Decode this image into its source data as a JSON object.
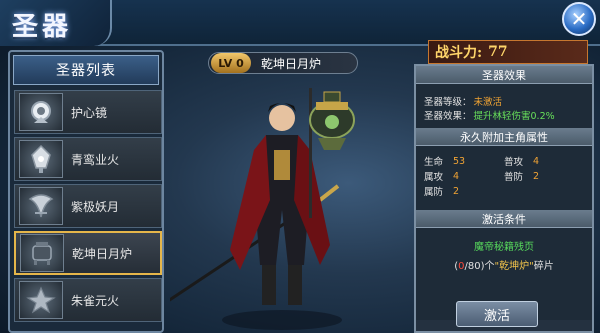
{
  "header": {
    "title": "圣器",
    "close_glyph": "✕"
  },
  "list": {
    "title": "圣器列表",
    "items": [
      {
        "label": "护心镜",
        "icon": "mirror-icon",
        "selected": false
      },
      {
        "label": "青鸾业火",
        "icon": "lantern-icon",
        "selected": false
      },
      {
        "label": "紫极妖月",
        "icon": "moon-blade-icon",
        "selected": false
      },
      {
        "label": "乾坤日月炉",
        "icon": "cauldron-icon",
        "selected": true
      },
      {
        "label": "朱雀元火",
        "icon": "phoenix-icon",
        "selected": false
      }
    ]
  },
  "artifact": {
    "level": "LV 0",
    "name": "乾坤日月炉"
  },
  "power": {
    "label": "战斗力:",
    "value": "77"
  },
  "effect": {
    "title": "圣器效果",
    "level_label": "圣器等级：",
    "level_value": "未激活",
    "skill_label": "圣器效果：",
    "skill_value": "提升林轻伤害0.2%"
  },
  "attrs": {
    "title": "永久附加主角属性",
    "items": [
      {
        "label": "生命",
        "value": "53"
      },
      {
        "label": "普攻",
        "value": "4"
      },
      {
        "label": "属攻",
        "value": "4"
      },
      {
        "label": "普防",
        "value": "2"
      },
      {
        "label": "属防",
        "value": "2"
      }
    ]
  },
  "activate": {
    "title": "激活条件",
    "material": "魔帝秘籍残页",
    "count_open": "(",
    "count_have": "0",
    "count_need": "/80",
    "count_mid": ")个",
    "item_name": "\"乾坤炉\"",
    "count_suffix": "碎片",
    "button_label": "激活"
  },
  "colors": {
    "accent_gold": "#e5b64a",
    "value_orange": "#f0a334",
    "value_green": "#68e05a",
    "power_gold": "#ffd56a"
  }
}
